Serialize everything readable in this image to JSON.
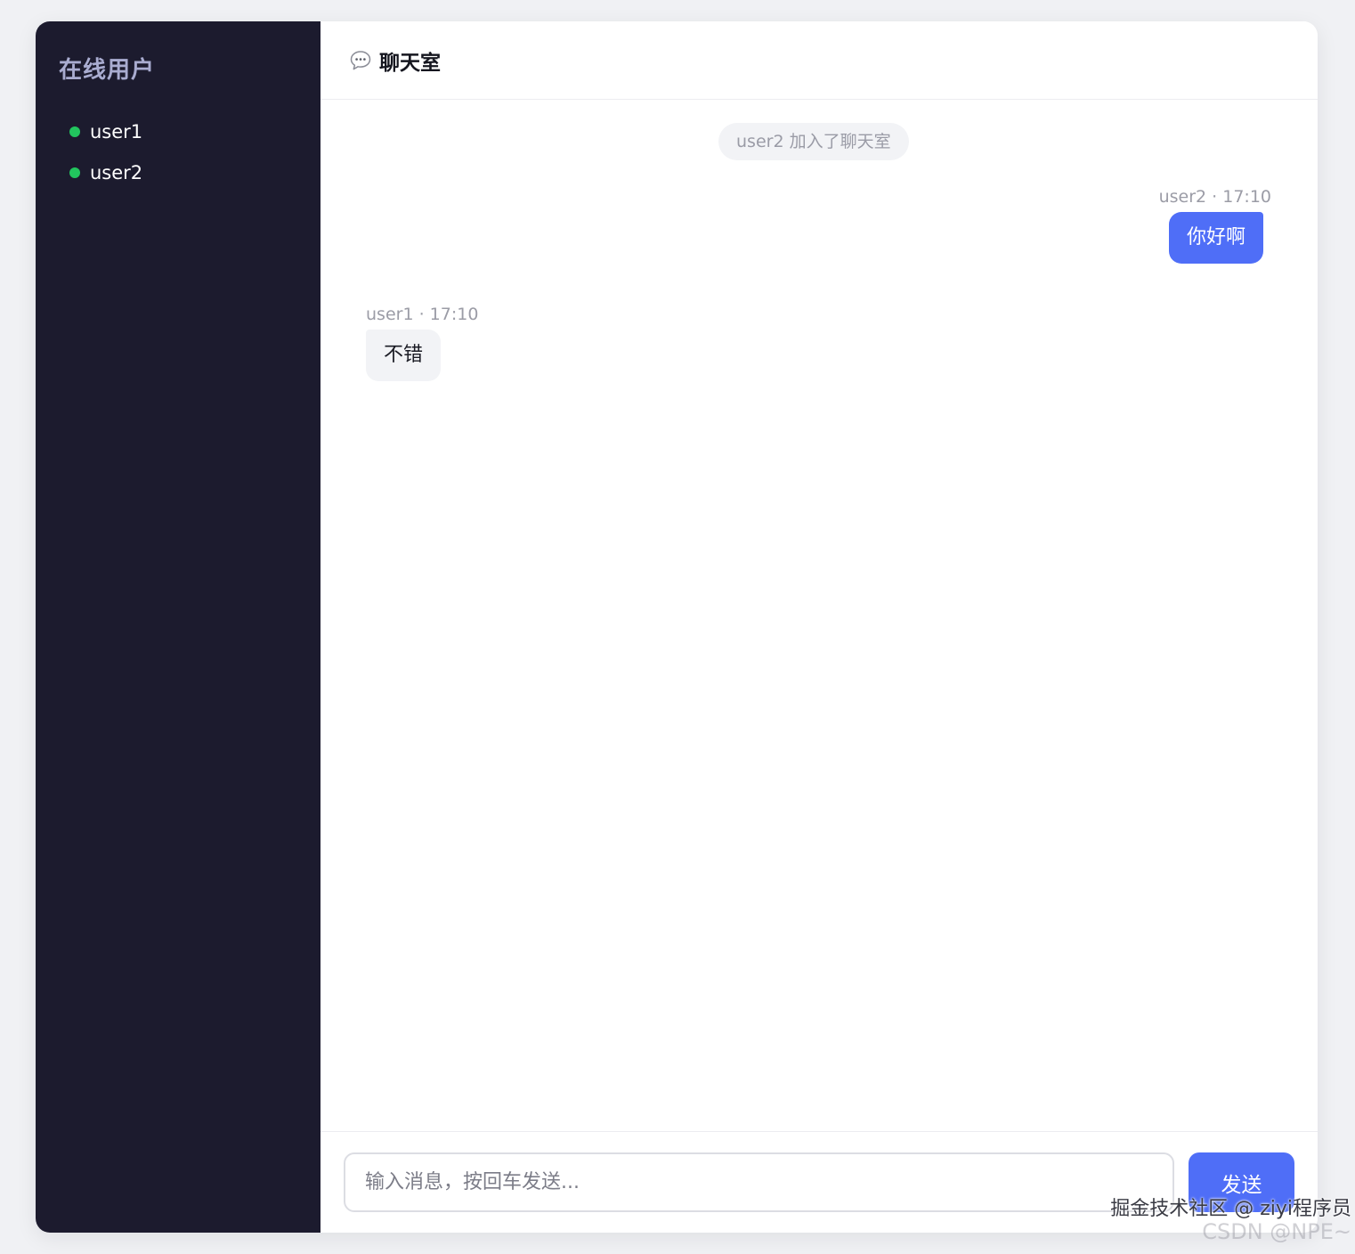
{
  "sidebar": {
    "title": "在线用户",
    "users": [
      {
        "name": "user1"
      },
      {
        "name": "user2"
      }
    ],
    "online_color": "#22c55e"
  },
  "header": {
    "icon": "speech-bubble-icon",
    "title": "聊天室"
  },
  "messages": {
    "system": "user2 加入了聊天室",
    "items": [
      {
        "sender": "user2",
        "time": "17:10",
        "meta": "user2 · 17:10",
        "text": "你好啊",
        "side": "right"
      },
      {
        "sender": "user1",
        "time": "17:10",
        "meta": "user1 · 17:10",
        "text": "不错",
        "side": "left"
      }
    ]
  },
  "composer": {
    "placeholder": "输入消息，按回车发送...",
    "value": "",
    "send_label": "发送"
  },
  "watermark": {
    "line1": "掘金技术社区 @ ziyi程序员",
    "line2": "CSDN @NPE~"
  },
  "colors": {
    "sidebar_bg": "#1c1b2e",
    "accent": "#4f6ef7",
    "page_bg": "#f0f1f4"
  }
}
